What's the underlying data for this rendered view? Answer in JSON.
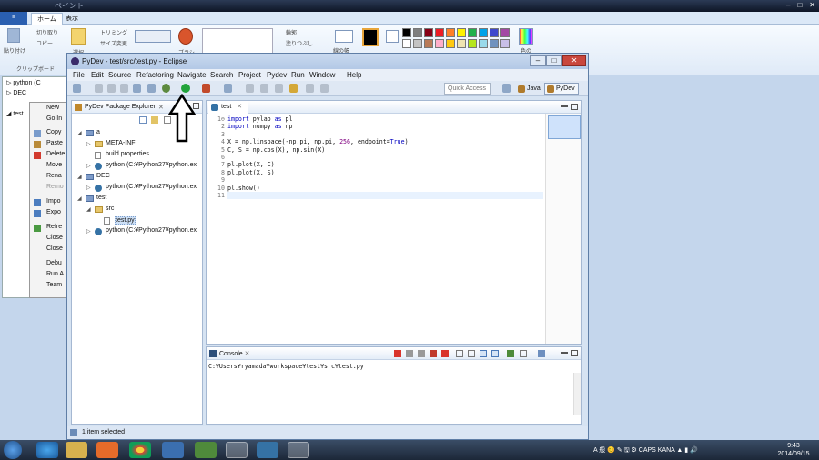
{
  "paint": {
    "title": "ペイント",
    "file_tab": "≡",
    "tabs": [
      "ホーム",
      "表示"
    ],
    "ribbon": {
      "paste_label": "貼り付け",
      "cut_label": "切り取り",
      "copy_label": "コピー",
      "clipboard_group": "クリップボード",
      "select_label": "選択",
      "crop_label": "トリミング",
      "resize_label": "サイズ変更",
      "brush_label": "ブラシ",
      "outline_label": "輪郭",
      "fill_label": "塗りつぶし",
      "size_label": "線の幅",
      "color_group": "色の"
    },
    "swatches": [
      "#000000",
      "#7f7f7f",
      "#880015",
      "#ed1c24",
      "#ff7f27",
      "#fff200",
      "#22b14c",
      "#00a2e8",
      "#3f48cc",
      "#a349a4",
      "#ffffff",
      "#c3c3c3",
      "#b97a57",
      "#ffaec9",
      "#ffc90e",
      "#efe4b0",
      "#b5e61d",
      "#99d9ea",
      "#7092be",
      "#c8bfe7"
    ]
  },
  "bg_tree": {
    "rows": [
      "python (C",
      "DEC",
      "test"
    ]
  },
  "context_menu": {
    "items": [
      {
        "label": "New",
        "enabled": true
      },
      {
        "label": "Go In",
        "enabled": true
      },
      {
        "label": "Copy",
        "enabled": true
      },
      {
        "label": "Paste",
        "enabled": true
      },
      {
        "label": "Delete",
        "enabled": true
      },
      {
        "label": "Move",
        "enabled": true
      },
      {
        "label": "Rena",
        "enabled": true
      },
      {
        "label": "Remo",
        "enabled": false
      },
      {
        "label": "Impo",
        "enabled": true
      },
      {
        "label": "Expo",
        "enabled": true
      },
      {
        "label": "Refre",
        "enabled": true
      },
      {
        "label": "Close",
        "enabled": true
      },
      {
        "label": "Close",
        "enabled": true
      },
      {
        "label": "Debu",
        "enabled": true
      },
      {
        "label": "Run A",
        "enabled": true
      },
      {
        "label": "Team",
        "enabled": true
      }
    ]
  },
  "eclipse": {
    "title": "PyDev - test/src/test.py - Eclipse",
    "window_buttons": {
      "minimize": "–",
      "maximize": "□",
      "close": "✕"
    },
    "menu": [
      "File",
      "Edit",
      "Source",
      "Refactoring",
      "Navigate",
      "Search",
      "Project",
      "Pydev",
      "Run",
      "Window",
      "Help"
    ],
    "quick_access_placeholder": "Quick Access",
    "perspectives": [
      {
        "label": "Java",
        "active": false
      },
      {
        "label": "PyDev",
        "active": true
      }
    ],
    "package_explorer": {
      "title": "PyDev Package Explorer",
      "close": "✕",
      "tree": [
        {
          "label": "a",
          "type": "proj",
          "indent": 0,
          "expanded": true
        },
        {
          "label": "META-INF",
          "type": "folder",
          "indent": 1,
          "expanded": false
        },
        {
          "label": "build.properties",
          "type": "file",
          "indent": 1
        },
        {
          "label": "python  (C:¥Python27¥python.ex",
          "type": "py",
          "indent": 1,
          "expanded": false
        },
        {
          "label": "DEC",
          "type": "proj",
          "indent": 0,
          "expanded": true
        },
        {
          "label": "python  (C:¥Python27¥python.ex",
          "type": "py",
          "indent": 1,
          "expanded": false
        },
        {
          "label": "test",
          "type": "proj",
          "indent": 0,
          "expanded": true
        },
        {
          "label": "src",
          "type": "folder",
          "indent": 1,
          "expanded": true
        },
        {
          "label": "test.py",
          "type": "pyfile",
          "indent": 2,
          "selected": true
        },
        {
          "label": "python  (C:¥Python27¥python.ex",
          "type": "py",
          "indent": 1,
          "expanded": false
        }
      ]
    },
    "editor": {
      "tab_label": "test",
      "tab_close": "✕",
      "lines": [
        {
          "n": "1⊖",
          "code": [
            [
              "kw",
              "import"
            ],
            [
              "t",
              " pylab "
            ],
            [
              "kw",
              "as"
            ],
            [
              "t",
              " pl"
            ]
          ]
        },
        {
          "n": "2",
          "code": [
            [
              "kw",
              "import"
            ],
            [
              "t",
              " numpy "
            ],
            [
              "kw",
              "as"
            ],
            [
              "t",
              " np"
            ]
          ]
        },
        {
          "n": "3",
          "code": []
        },
        {
          "n": "4",
          "code": [
            [
              "t",
              "X = np.linspace(-np.pi, np.pi, "
            ],
            [
              "num",
              "256"
            ],
            [
              "t",
              ", endpoint="
            ],
            [
              "kw",
              "True"
            ],
            [
              "t",
              ")"
            ]
          ]
        },
        {
          "n": "5",
          "code": [
            [
              "t",
              "C, S = np.cos(X), np.sin(X)"
            ]
          ]
        },
        {
          "n": "6",
          "code": []
        },
        {
          "n": "7",
          "code": [
            [
              "t",
              "pl.plot(X, C)"
            ]
          ]
        },
        {
          "n": "8",
          "code": [
            [
              "t",
              "pl.plot(X, S)"
            ]
          ]
        },
        {
          "n": "9",
          "code": []
        },
        {
          "n": "10",
          "code": [
            [
              "t",
              "pl.show()"
            ]
          ]
        },
        {
          "n": "11",
          "code": [],
          "current": true
        }
      ]
    },
    "console": {
      "title": "Console",
      "close": "✕",
      "path": "C:¥Users¥ryamada¥workspace¥test¥src¥test.py"
    },
    "status": "1 item selected"
  },
  "taskbar": {
    "tray_text": "A 般 😊 ✎ 🖫 ⚙ CAPS KANA ▲ ▮ 🔊",
    "time": "9:43",
    "date": "2014/09/15"
  },
  "annotation": {
    "arrow_color": "#000000",
    "arrow_fill": "#ffffff"
  }
}
